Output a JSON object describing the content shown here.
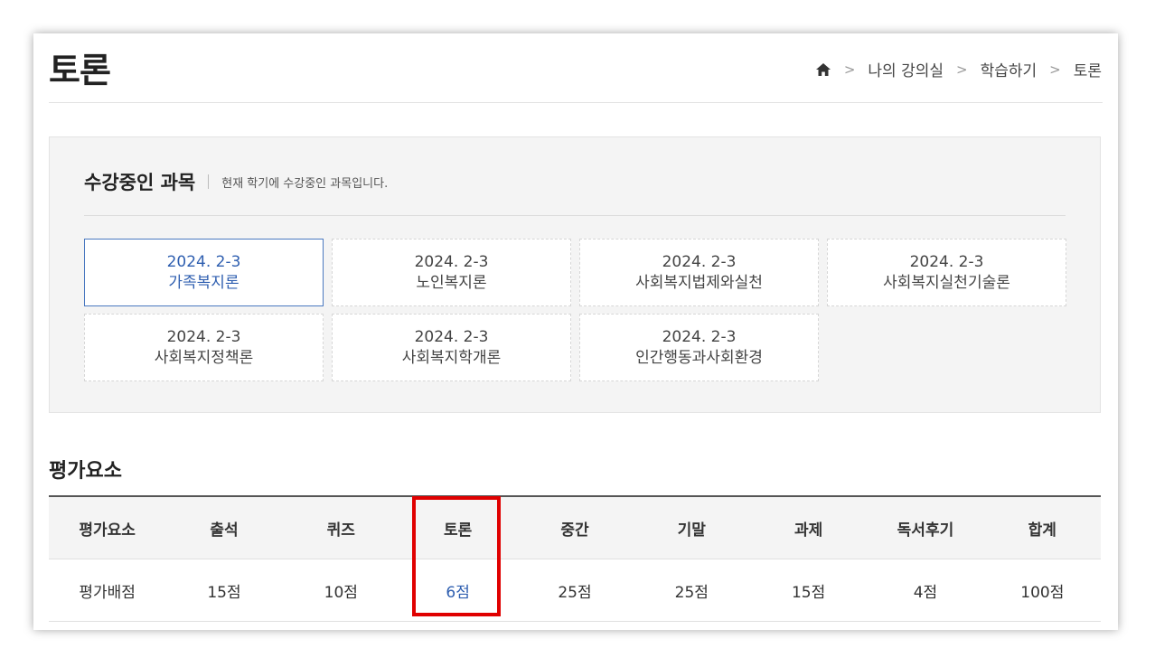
{
  "page": {
    "title": "토론",
    "breadcrumb": [
      "나의 강의실",
      "학습하기",
      "토론"
    ],
    "breadcrumb_sep": ">"
  },
  "courses": {
    "title": "수강중인 과목",
    "subtitle": "현재 학기에 수강중인 과목입니다.",
    "items": [
      {
        "term": "2024. 2-3",
        "name": "가족복지론",
        "active": true
      },
      {
        "term": "2024. 2-3",
        "name": "노인복지론",
        "active": false
      },
      {
        "term": "2024. 2-3",
        "name": "사회복지법제와실천",
        "active": false
      },
      {
        "term": "2024. 2-3",
        "name": "사회복지실천기술론",
        "active": false
      },
      {
        "term": "2024. 2-3",
        "name": "사회복지정책론",
        "active": false
      },
      {
        "term": "2024. 2-3",
        "name": "사회복지학개론",
        "active": false
      },
      {
        "term": "2024. 2-3",
        "name": "인간행동과사회환경",
        "active": false
      }
    ]
  },
  "evaluation": {
    "title": "평가요소",
    "headers": [
      "평가요소",
      "출석",
      "퀴즈",
      "토론",
      "중간",
      "기말",
      "과제",
      "독서후기",
      "합계"
    ],
    "row": [
      "평가배점",
      "15점",
      "10점",
      "6점",
      "25점",
      "25점",
      "15점",
      "4점",
      "100점"
    ],
    "highlight_column": 3
  },
  "colors": {
    "accent": "#2f5fb0",
    "highlight_box": "#e00000"
  },
  "icons": {
    "home": "home-icon",
    "separator": "chevron-right-icon"
  }
}
